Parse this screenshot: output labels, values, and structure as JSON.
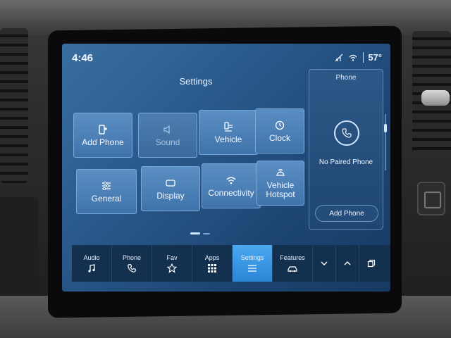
{
  "status": {
    "time": "4:46",
    "temperature": "57°"
  },
  "settings": {
    "title": "Settings",
    "tiles": [
      {
        "label": "Add Phone",
        "icon": "phone-add-icon"
      },
      {
        "label": "Sound",
        "icon": "speaker-icon"
      },
      {
        "label": "Vehicle",
        "icon": "vehicle-settings-icon"
      },
      {
        "label": "Clock",
        "icon": "clock-icon"
      },
      {
        "label": "General",
        "icon": "sliders-icon"
      },
      {
        "label": "Display",
        "icon": "display-icon"
      },
      {
        "label": "Connectivity",
        "icon": "wifi-icon"
      },
      {
        "label": "Vehicle Hotspot",
        "icon": "hotspot-icon"
      }
    ]
  },
  "phone_panel": {
    "title": "Phone",
    "status": "No Paired Phone",
    "button": "Add Phone"
  },
  "bottom_bar": {
    "items": [
      {
        "label": "Audio",
        "icon": "music-note-icon"
      },
      {
        "label": "Phone",
        "icon": "phone-icon"
      },
      {
        "label": "Fav",
        "icon": "star-icon"
      },
      {
        "label": "Apps",
        "icon": "apps-grid-icon"
      },
      {
        "label": "Settings",
        "icon": "settings-lines-icon",
        "active": true
      },
      {
        "label": "Features",
        "icon": "car-icon"
      }
    ],
    "controls": [
      "chevron-down-icon",
      "chevron-up-icon",
      "windows-icon"
    ]
  },
  "colors": {
    "accent": "#2b86d6",
    "screen_bg": "#2a5a8c"
  }
}
